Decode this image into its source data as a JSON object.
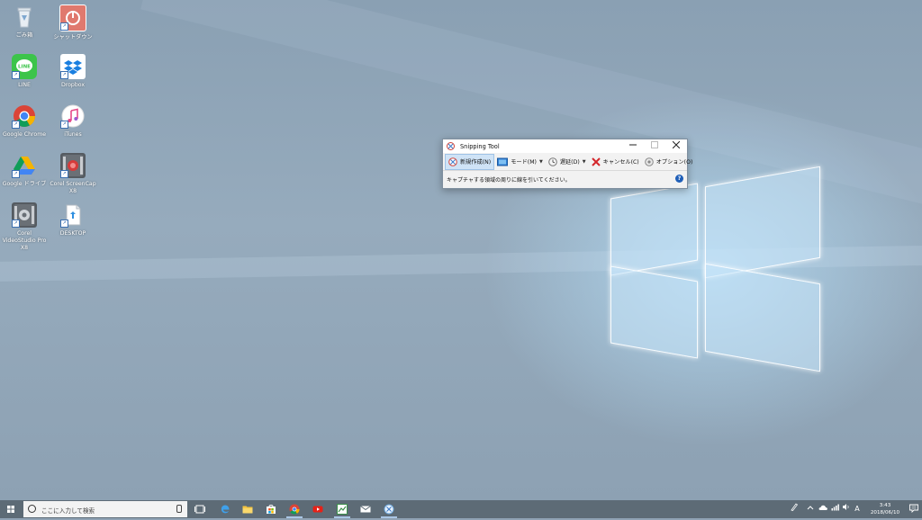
{
  "desktop": {
    "icons": [
      {
        "label": "ごみ箱"
      },
      {
        "label": "シャットダウン"
      },
      {
        "label": "LINE"
      },
      {
        "label": "Dropbox"
      },
      {
        "label": "Google Chrome"
      },
      {
        "label": "iTunes"
      },
      {
        "label": "Google ドライブ"
      },
      {
        "label": "Corel ScreenCap X8"
      },
      {
        "label": "Corel VideoStudio Pro X8"
      },
      {
        "label": "DESKTOP"
      }
    ]
  },
  "snipping_tool": {
    "title": "Snipping Tool",
    "toolbar": {
      "new_label": "新規作成(N)",
      "mode_label": "モード(M)",
      "delay_label": "遅延(D)",
      "cancel_label": "キャンセル(C)",
      "options_label": "オプション(O)"
    },
    "status_text": "キャプチャする領域の周りに線を引いてください。",
    "help_glyph": "?"
  },
  "taskbar": {
    "search_placeholder": "ここに入力して検索",
    "ime_label": "A",
    "time": "3:43",
    "date": "2018/06/10"
  },
  "colors": {
    "taskbar": "#5d6b76",
    "accent": "#1f5fb8",
    "active_button": "#cfe3f6"
  }
}
